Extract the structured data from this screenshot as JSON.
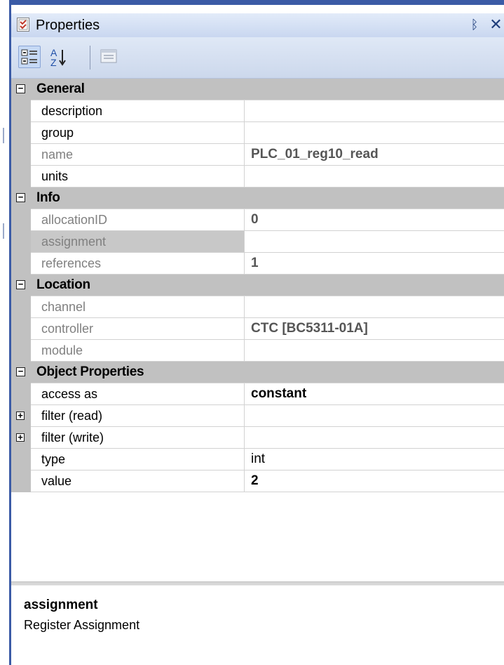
{
  "window": {
    "title": "Properties",
    "pin_glyph": "ᛒ",
    "close_glyph": "✕"
  },
  "toolbar": {
    "buttons": [
      {
        "name": "categorized-icon",
        "active": true
      },
      {
        "name": "alphabetical-sort-icon",
        "active": false
      },
      {
        "name": "property-pages-icon",
        "active": false
      }
    ],
    "sort_letters": {
      "top": "A",
      "bottom": "Z"
    }
  },
  "grid": {
    "categories": [
      {
        "label": "General",
        "toggle": "−",
        "rows": [
          {
            "name": "description",
            "value": "",
            "readonly": false
          },
          {
            "name": "group",
            "value": "",
            "readonly": false
          },
          {
            "name": "name",
            "value": "PLC_01_reg10_read",
            "readonly": true
          },
          {
            "name": "units",
            "value": "",
            "readonly": false
          }
        ]
      },
      {
        "label": "Info",
        "toggle": "−",
        "rows": [
          {
            "name": "allocationID",
            "value": "0",
            "readonly": true
          },
          {
            "name": "assignment",
            "value": "",
            "readonly": true,
            "selected": true
          },
          {
            "name": "references",
            "value": "1",
            "readonly": true
          }
        ]
      },
      {
        "label": "Location",
        "toggle": "−",
        "rows": [
          {
            "name": "channel",
            "value": "",
            "readonly": true
          },
          {
            "name": "controller",
            "value": "CTC [BC5311-01A]",
            "readonly": true
          },
          {
            "name": "module",
            "value": "",
            "readonly": true
          }
        ]
      },
      {
        "label": "Object Properties",
        "toggle": "−",
        "rows": [
          {
            "name": "access as",
            "value": "constant",
            "readonly": false
          },
          {
            "name": "filter (read)",
            "value": "",
            "readonly": false,
            "expander": "+"
          },
          {
            "name": "filter (write)",
            "value": "",
            "readonly": false,
            "expander": "+"
          },
          {
            "name": "type",
            "value": "int",
            "readonly": false,
            "normal_weight": true
          },
          {
            "name": "value",
            "value": "2",
            "readonly": false
          }
        ]
      }
    ]
  },
  "description": {
    "title": "assignment",
    "text": "Register Assignment"
  },
  "colors": {
    "frame": "#3b5ba6",
    "category_bg": "#c1c1c1",
    "readonly_text": "#808080"
  }
}
